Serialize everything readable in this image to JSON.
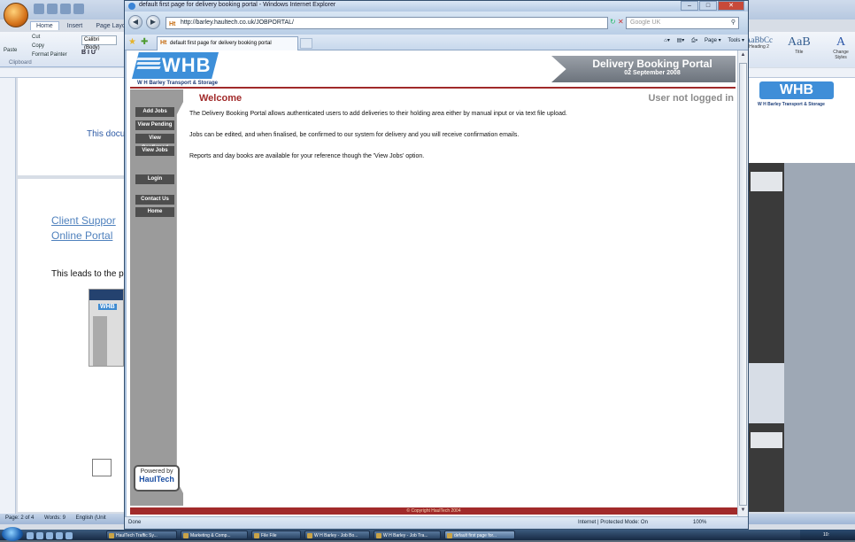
{
  "word": {
    "tabs": [
      "Home",
      "Insert",
      "Page Layout"
    ],
    "clipboard": {
      "cut": "Cut",
      "copy": "Copy",
      "paste": "Paste",
      "format_painter": "Format Painter",
      "group": "Clipboard"
    },
    "font_name": "Calibri (Body)",
    "format_buttons": "B I U",
    "styles": [
      {
        "preview": "AaBbCc",
        "caption": "Heading 2"
      },
      {
        "preview": "AaB",
        "caption": "Title"
      },
      {
        "preview": "A",
        "caption": "Change Styles"
      }
    ],
    "doc": {
      "fragment1": "This docu",
      "fragment2_line1": "Client Suppor",
      "fragment2_line2": "Online Portal",
      "fragment3": "This leads to the p"
    },
    "right_logo": "WHB",
    "right_sub": "W H Barley Transport & Storage",
    "status": {
      "page": "Page: 2 of 4",
      "words": "Words: 9",
      "lang": "English (Unit"
    }
  },
  "ie": {
    "window_title": "default first page for delivery booking portal - Windows Internet Explorer",
    "url": "http://barley.haultech.co.uk/JOBPORTAL/",
    "search_placeholder": "Google UK",
    "tab_title": "default first page for delivery booking portal",
    "commands": [
      "Page ▾",
      "Tools ▾"
    ],
    "status_left": "Done",
    "status_zone": "Internet | Protected Mode: On",
    "status_zoom": "100%"
  },
  "portal": {
    "logo": "WHB",
    "logo_sub": "W H Barley Transport & Storage",
    "banner_title": "Delivery Booking Portal",
    "banner_date": "02 September 2008",
    "heading": "Welcome",
    "login_status": "User not logged in",
    "paragraphs": [
      "The Delivery Booking Portal allows authenticated users to add deliveries to their holding area either by manual input or via text file upload.",
      "Jobs can be edited, and when finalised, be confirmed to our system for delivery and you will receive confirmation emails.",
      "Reports and day books are available for your reference though the 'View Jobs' option."
    ],
    "menu": {
      "add_jobs": "Add Jobs",
      "view_pending": "View Pending",
      "view_confirmed": "View Confirmed",
      "view_jobs": "View Jobs",
      "login": "Login",
      "contact_us": "Contact Us",
      "home": "Home"
    },
    "powered_by": "Powered by",
    "powered_brand": "HaulTech",
    "footer": "© Copyright  HaulTech 2004"
  },
  "taskbar": {
    "tasks": [
      "HaulTech Traffic Sy...",
      "Marketing & Comp...",
      "File File",
      "W H Barley - Job Bo...",
      "W H Barley - Job Tra...",
      "default first page for..."
    ],
    "clock": "10:"
  },
  "colors": {
    "accent_red": "#a12a2a",
    "logo_blue": "#3d8fd9",
    "sidebar_grey": "#9b9b9b"
  }
}
